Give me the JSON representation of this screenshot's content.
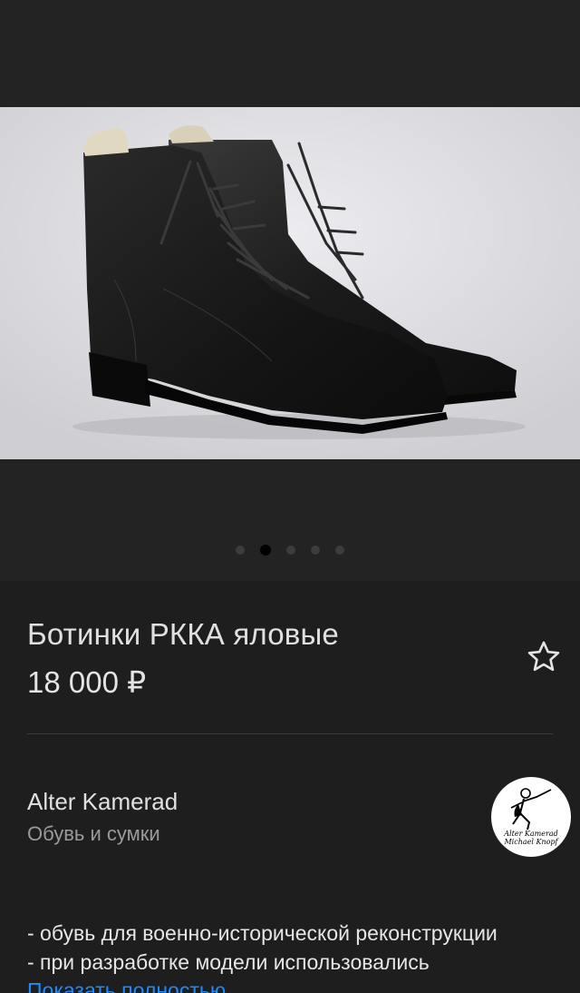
{
  "gallery": {
    "image_alt": "black leather boots",
    "dots_total": 5,
    "active_dot_index": 1
  },
  "product": {
    "title": "Ботинки РККА яловые",
    "price": "18 000 ₽",
    "favorite_icon": "star-outline-icon"
  },
  "seller": {
    "name": "Alter Kamerad",
    "category": "Обувь и сумки",
    "avatar_logo_lines": [
      "Alter Kamerad",
      "Michael Knopf"
    ]
  },
  "description": {
    "lines": [
      "- обувь для военно-исторической реконструкции",
      "- при разработке модели использовались"
    ],
    "show_more_label": "Показать полностью"
  },
  "colors": {
    "background": "#1e1e1e",
    "link": "#1a8cff",
    "muted_text": "#9a9a9a"
  }
}
